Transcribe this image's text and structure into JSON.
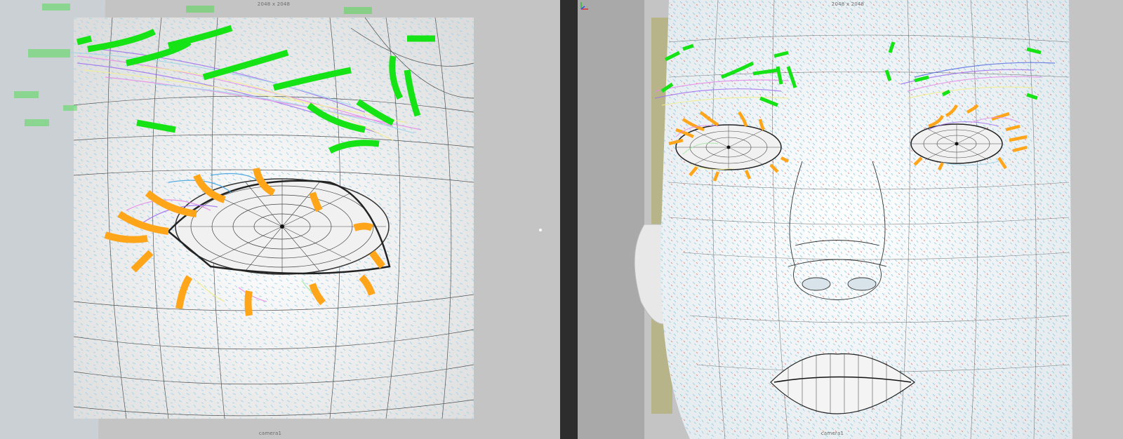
{
  "viewports": [
    {
      "id": "left",
      "resolution_label": "2048 x 2048",
      "camera_label": "camera1"
    },
    {
      "id": "right",
      "resolution_label": "2048 x 2048",
      "camera_label": "camera1"
    }
  ],
  "colors": {
    "viewport_bg": "#c9c9c9",
    "separator": "#2d2d2d",
    "wireframe": "#222222",
    "hair_fibers": "#9fd4ea",
    "eyebrow_guides": "#16e316",
    "eyelash_guides": "#ffa51a",
    "fiber_pink": "#e58be8",
    "fiber_purple": "#a070f0",
    "fiber_yellow": "#f2ee8c"
  },
  "icons": [
    "axis-gizmo-icon"
  ]
}
